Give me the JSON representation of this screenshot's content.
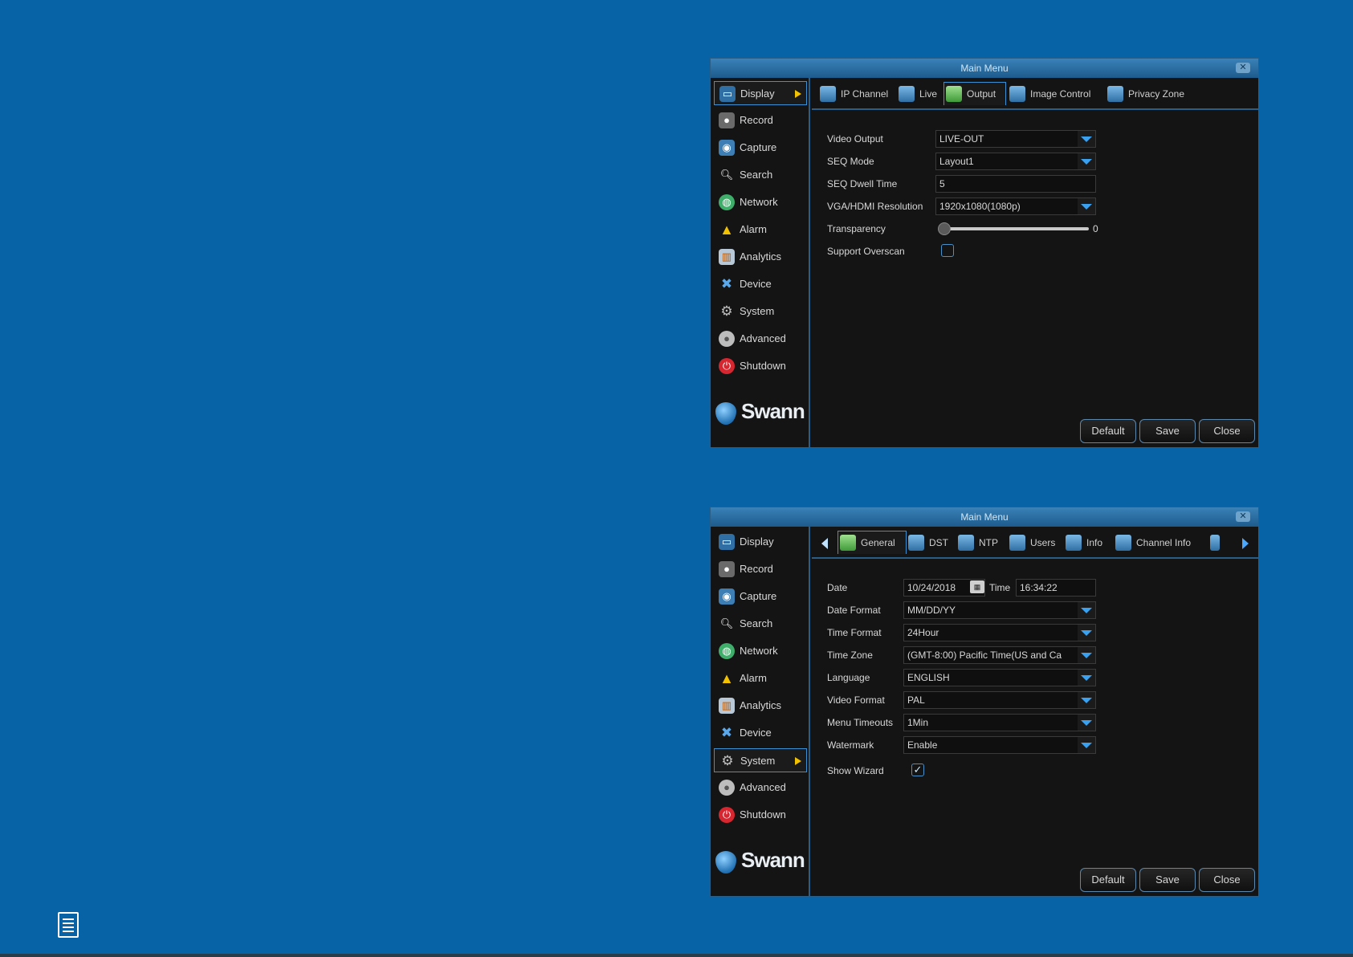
{
  "screen1": {
    "title": "Main Menu",
    "close_icon": "close-icon",
    "sidebar": [
      {
        "label": "Display",
        "icon": "display-icon",
        "active": true
      },
      {
        "label": "Record",
        "icon": "record-icon"
      },
      {
        "label": "Capture",
        "icon": "capture-icon"
      },
      {
        "label": "Search",
        "icon": "search-icon"
      },
      {
        "label": "Network",
        "icon": "network-icon"
      },
      {
        "label": "Alarm",
        "icon": "alarm-icon"
      },
      {
        "label": "Analytics",
        "icon": "analytics-icon"
      },
      {
        "label": "Device",
        "icon": "device-icon"
      },
      {
        "label": "System",
        "icon": "gear-icon"
      },
      {
        "label": "Advanced",
        "icon": "advanced-icon"
      },
      {
        "label": "Shutdown",
        "icon": "power-icon"
      }
    ],
    "tabs": [
      {
        "label": "IP Channel"
      },
      {
        "label": "Live"
      },
      {
        "label": "Output",
        "active": true
      },
      {
        "label": "Image Control"
      },
      {
        "label": "Privacy Zone"
      }
    ],
    "form": {
      "video_output": {
        "label": "Video Output",
        "value": "LIVE-OUT"
      },
      "seq_mode": {
        "label": "SEQ Mode",
        "value": "Layout1"
      },
      "seq_dwell": {
        "label": "SEQ Dwell Time",
        "value": "5"
      },
      "resolution": {
        "label": "VGA/HDMI Resolution",
        "value": "1920x1080(1080p)"
      },
      "transparency": {
        "label": "Transparency",
        "value": "0"
      },
      "overscan": {
        "label": "Support Overscan",
        "checked": false
      }
    },
    "buttons": {
      "default": "Default",
      "save": "Save",
      "close": "Close"
    }
  },
  "screen2": {
    "title": "Main Menu",
    "close_icon": "close-icon",
    "sidebar": [
      {
        "label": "Display",
        "icon": "display-icon"
      },
      {
        "label": "Record",
        "icon": "record-icon"
      },
      {
        "label": "Capture",
        "icon": "capture-icon"
      },
      {
        "label": "Search",
        "icon": "search-icon"
      },
      {
        "label": "Network",
        "icon": "network-icon"
      },
      {
        "label": "Alarm",
        "icon": "alarm-icon"
      },
      {
        "label": "Analytics",
        "icon": "analytics-icon"
      },
      {
        "label": "Device",
        "icon": "device-icon"
      },
      {
        "label": "System",
        "icon": "gear-icon",
        "active": true
      },
      {
        "label": "Advanced",
        "icon": "advanced-icon"
      },
      {
        "label": "Shutdown",
        "icon": "power-icon"
      }
    ],
    "tabs": [
      {
        "label": "General",
        "active": true
      },
      {
        "label": "DST"
      },
      {
        "label": "NTP"
      },
      {
        "label": "Users"
      },
      {
        "label": "Info"
      },
      {
        "label": "Channel Info"
      }
    ],
    "form": {
      "date": {
        "label": "Date",
        "value": "10/24/2018"
      },
      "time": {
        "label": "Time",
        "value": "16:34:22"
      },
      "date_format": {
        "label": "Date Format",
        "value": "MM/DD/YY"
      },
      "time_format": {
        "label": "Time Format",
        "value": "24Hour"
      },
      "time_zone": {
        "label": "Time Zone",
        "value": "(GMT-8:00) Pacific Time(US and Ca"
      },
      "language": {
        "label": "Language",
        "value": "ENGLISH"
      },
      "video_format": {
        "label": "Video Format",
        "value": "PAL"
      },
      "menu_timeouts": {
        "label": "Menu Timeouts",
        "value": "1Min"
      },
      "watermark": {
        "label": "Watermark",
        "value": "Enable"
      },
      "show_wizard": {
        "label": "Show Wizard",
        "checked": true
      }
    },
    "buttons": {
      "default": "Default",
      "save": "Save",
      "close": "Close"
    }
  },
  "logo_text": "Swann",
  "colors": {
    "page_bg": "#0762a6",
    "screen_bg": "#141414",
    "accent": "#3b8fd3",
    "active_arrow": "#f2c200"
  }
}
